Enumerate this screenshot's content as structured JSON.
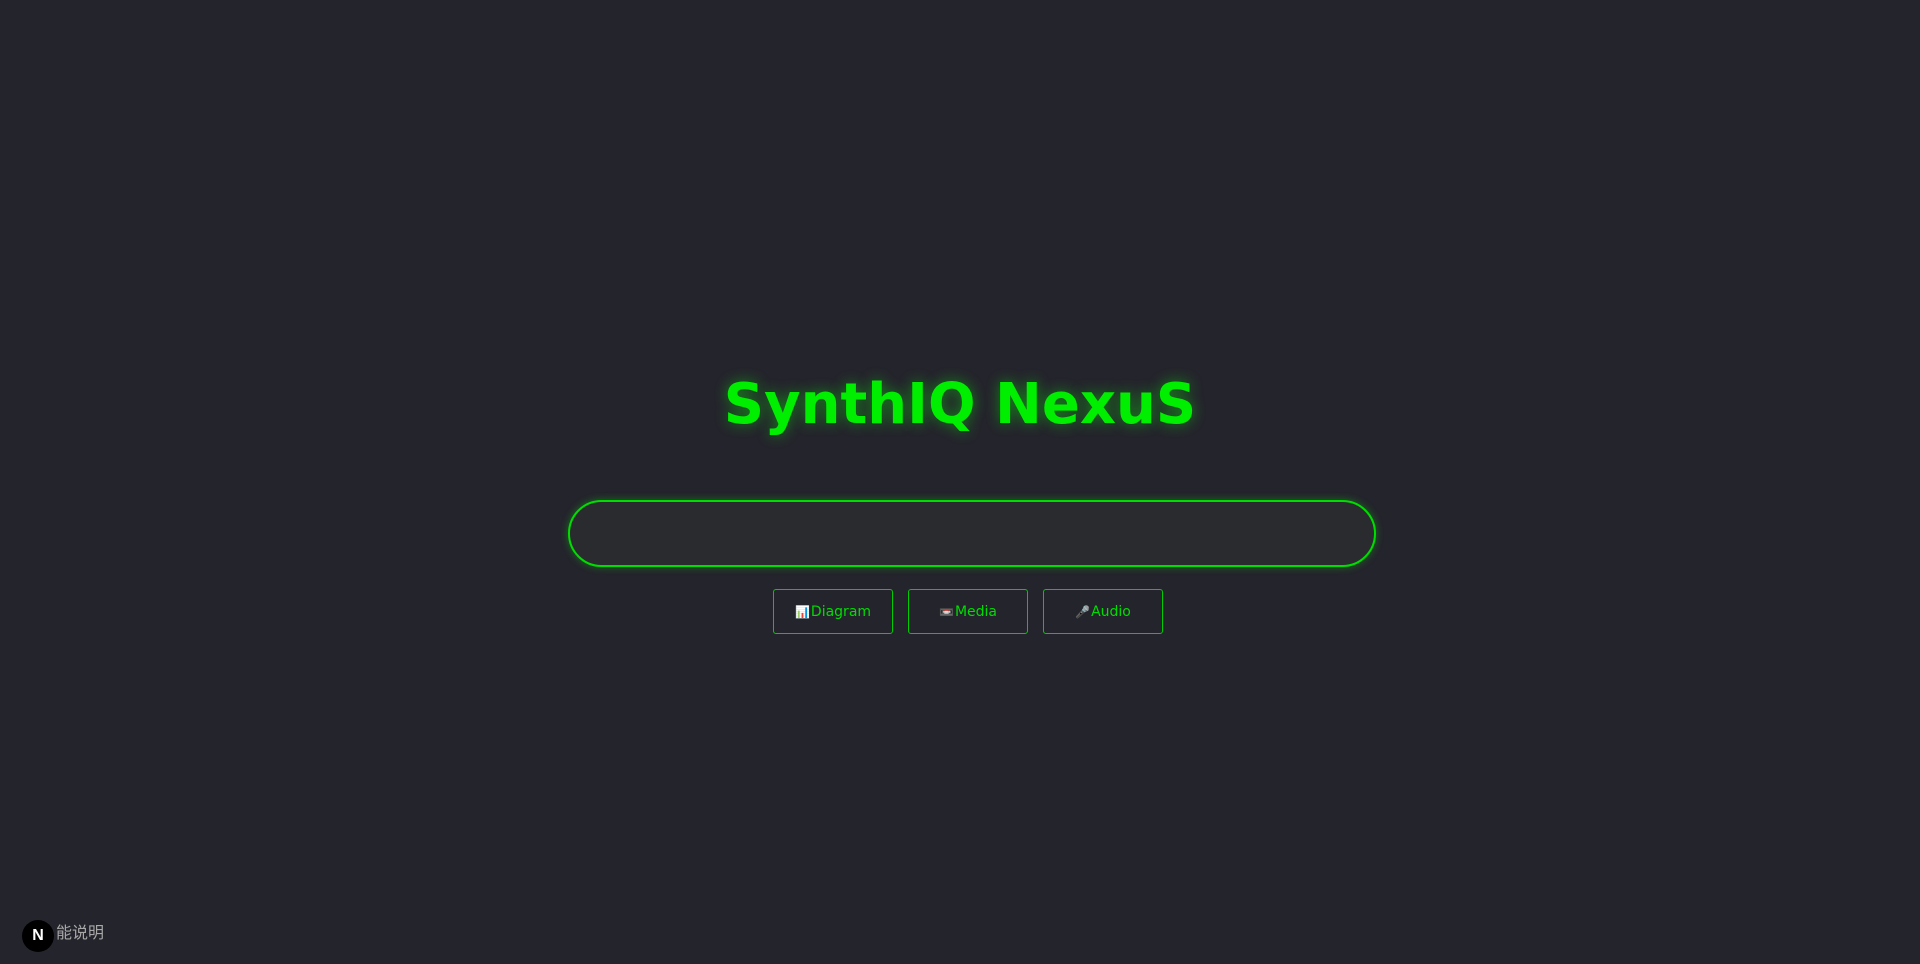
{
  "page": {
    "title": "SynthIQ NexuS",
    "accent_color": "#00ee00",
    "background_color": "#24242c"
  },
  "search": {
    "value": "",
    "placeholder": ""
  },
  "actions": [
    {
      "icon": "📊",
      "icon_name": "bar-chart-icon",
      "label": "Diagram"
    },
    {
      "icon": "📼",
      "icon_name": "videocassette-icon",
      "label": "Media"
    },
    {
      "icon": "🎤",
      "icon_name": "microphone-icon",
      "label": "Audio"
    }
  ],
  "dev_indicator": {
    "logo_letter": "N",
    "label": "能说明"
  }
}
